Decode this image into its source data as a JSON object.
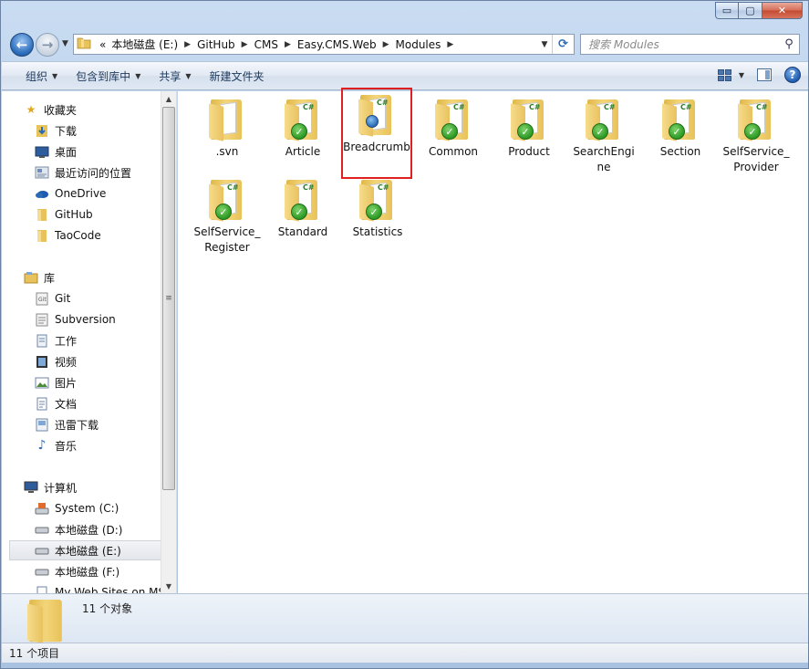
{
  "window": {
    "controls": {
      "minimize": "▭",
      "maximize": "▢",
      "close": "✕"
    }
  },
  "nav": {
    "back": "←",
    "forward": "→",
    "breadcrumbs": [
      "«",
      "本地磁盘 (E:)",
      "GitHub",
      "CMS",
      "Easy.CMS.Web",
      "Modules"
    ],
    "search_placeholder": "搜索 Modules"
  },
  "toolbar": {
    "organize": "组织",
    "include_in_library": "包含到库中",
    "share": "共享",
    "new_folder": "新建文件夹"
  },
  "sidebar": {
    "favorites_header": "收藏夹",
    "favorites": [
      {
        "label": "下载",
        "icon": "download-folder-icon"
      },
      {
        "label": "桌面",
        "icon": "desktop-icon"
      },
      {
        "label": "最近访问的位置",
        "icon": "recent-places-icon"
      },
      {
        "label": "OneDrive",
        "icon": "onedrive-icon"
      },
      {
        "label": "GitHub",
        "icon": "folder-icon"
      },
      {
        "label": "TaoCode",
        "icon": "folder-icon"
      }
    ],
    "libraries_header": "库",
    "libraries": [
      {
        "label": "Git",
        "icon": "git-library-icon"
      },
      {
        "label": "Subversion",
        "icon": "subversion-library-icon"
      },
      {
        "label": "工作",
        "icon": "work-library-icon"
      },
      {
        "label": "视频",
        "icon": "video-library-icon"
      },
      {
        "label": "图片",
        "icon": "pictures-library-icon"
      },
      {
        "label": "文档",
        "icon": "documents-library-icon"
      },
      {
        "label": "迅雷下载",
        "icon": "thunder-download-icon"
      },
      {
        "label": "音乐",
        "icon": "music-library-icon"
      }
    ],
    "computer_header": "计算机",
    "drives": [
      {
        "label": "System (C:)",
        "icon": "system-drive-icon"
      },
      {
        "label": "本地磁盘 (D:)",
        "icon": "drive-icon"
      },
      {
        "label": "本地磁盘 (E:)",
        "icon": "drive-icon",
        "selected": true
      },
      {
        "label": "本地磁盘 (F:)",
        "icon": "drive-icon"
      },
      {
        "label": "My Web Sites on MSN",
        "icon": "web-sites-icon"
      }
    ]
  },
  "files": [
    {
      "name": ".svn",
      "type": "plain"
    },
    {
      "name": "Article",
      "type": "csharp-ok"
    },
    {
      "name": "Breadcrumb",
      "type": "csharp-new",
      "highlighted": true
    },
    {
      "name": "Common",
      "type": "csharp-ok"
    },
    {
      "name": "Product",
      "type": "csharp-ok"
    },
    {
      "name": "SearchEngine",
      "type": "csharp-ok"
    },
    {
      "name": "Section",
      "type": "csharp-ok"
    },
    {
      "name": "SelfService_Provider",
      "type": "csharp-ok"
    },
    {
      "name": "SelfService_Register",
      "type": "csharp-ok"
    },
    {
      "name": "Standard",
      "type": "csharp-ok"
    },
    {
      "name": "Statistics",
      "type": "csharp-ok"
    }
  ],
  "details": {
    "count_text": "11 个对象"
  },
  "status": {
    "items_text": "11 个项目"
  },
  "colors": {
    "highlight_border": "#e02020",
    "ok_badge": "#2c9a24",
    "folder": "#f3d57a"
  }
}
